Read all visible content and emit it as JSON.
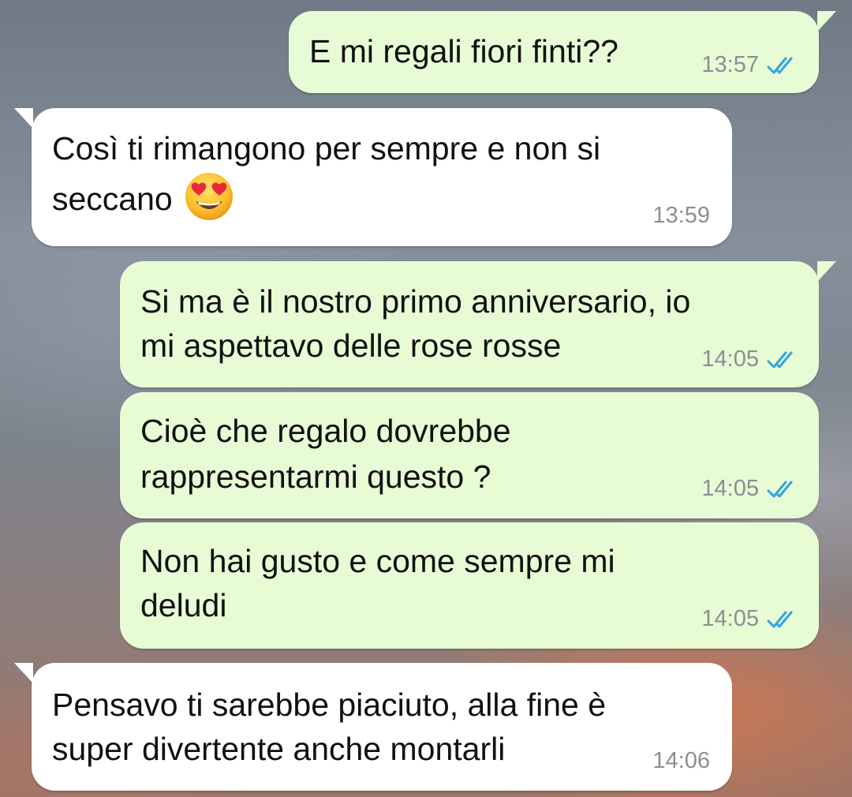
{
  "colors": {
    "outgoing_bubble": "#e7fbd5",
    "incoming_bubble": "#ffffff",
    "read_ticks": "#34a4e0",
    "timestamp": "#8a8f93"
  },
  "messages": [
    {
      "direction": "out",
      "lines": [
        "E mi regali fiori finti??"
      ],
      "time": "13:57",
      "status_icon": "double-check-read-icon"
    },
    {
      "direction": "in",
      "lines": [
        "Così ti rimangono per sempre e non si",
        "seccano"
      ],
      "emoji": "smiling-face-with-heart-eyes",
      "time": "13:59"
    },
    {
      "direction": "out",
      "lines": [
        "Si ma è il nostro primo anniversario, io",
        "mi aspettavo delle rose rosse"
      ],
      "time": "14:05",
      "status_icon": "double-check-read-icon"
    },
    {
      "direction": "out",
      "lines": [
        "Cioè che regalo dovrebbe",
        "rappresentarmi questo ?"
      ],
      "time": "14:05",
      "status_icon": "double-check-read-icon"
    },
    {
      "direction": "out",
      "lines": [
        "Non hai gusto e come sempre mi",
        "deludi"
      ],
      "time": "14:05",
      "status_icon": "double-check-read-icon"
    },
    {
      "direction": "in",
      "lines": [
        "Pensavo ti sarebbe piaciuto, alla fine è",
        "super divertente anche montarli"
      ],
      "time": "14:06"
    }
  ]
}
